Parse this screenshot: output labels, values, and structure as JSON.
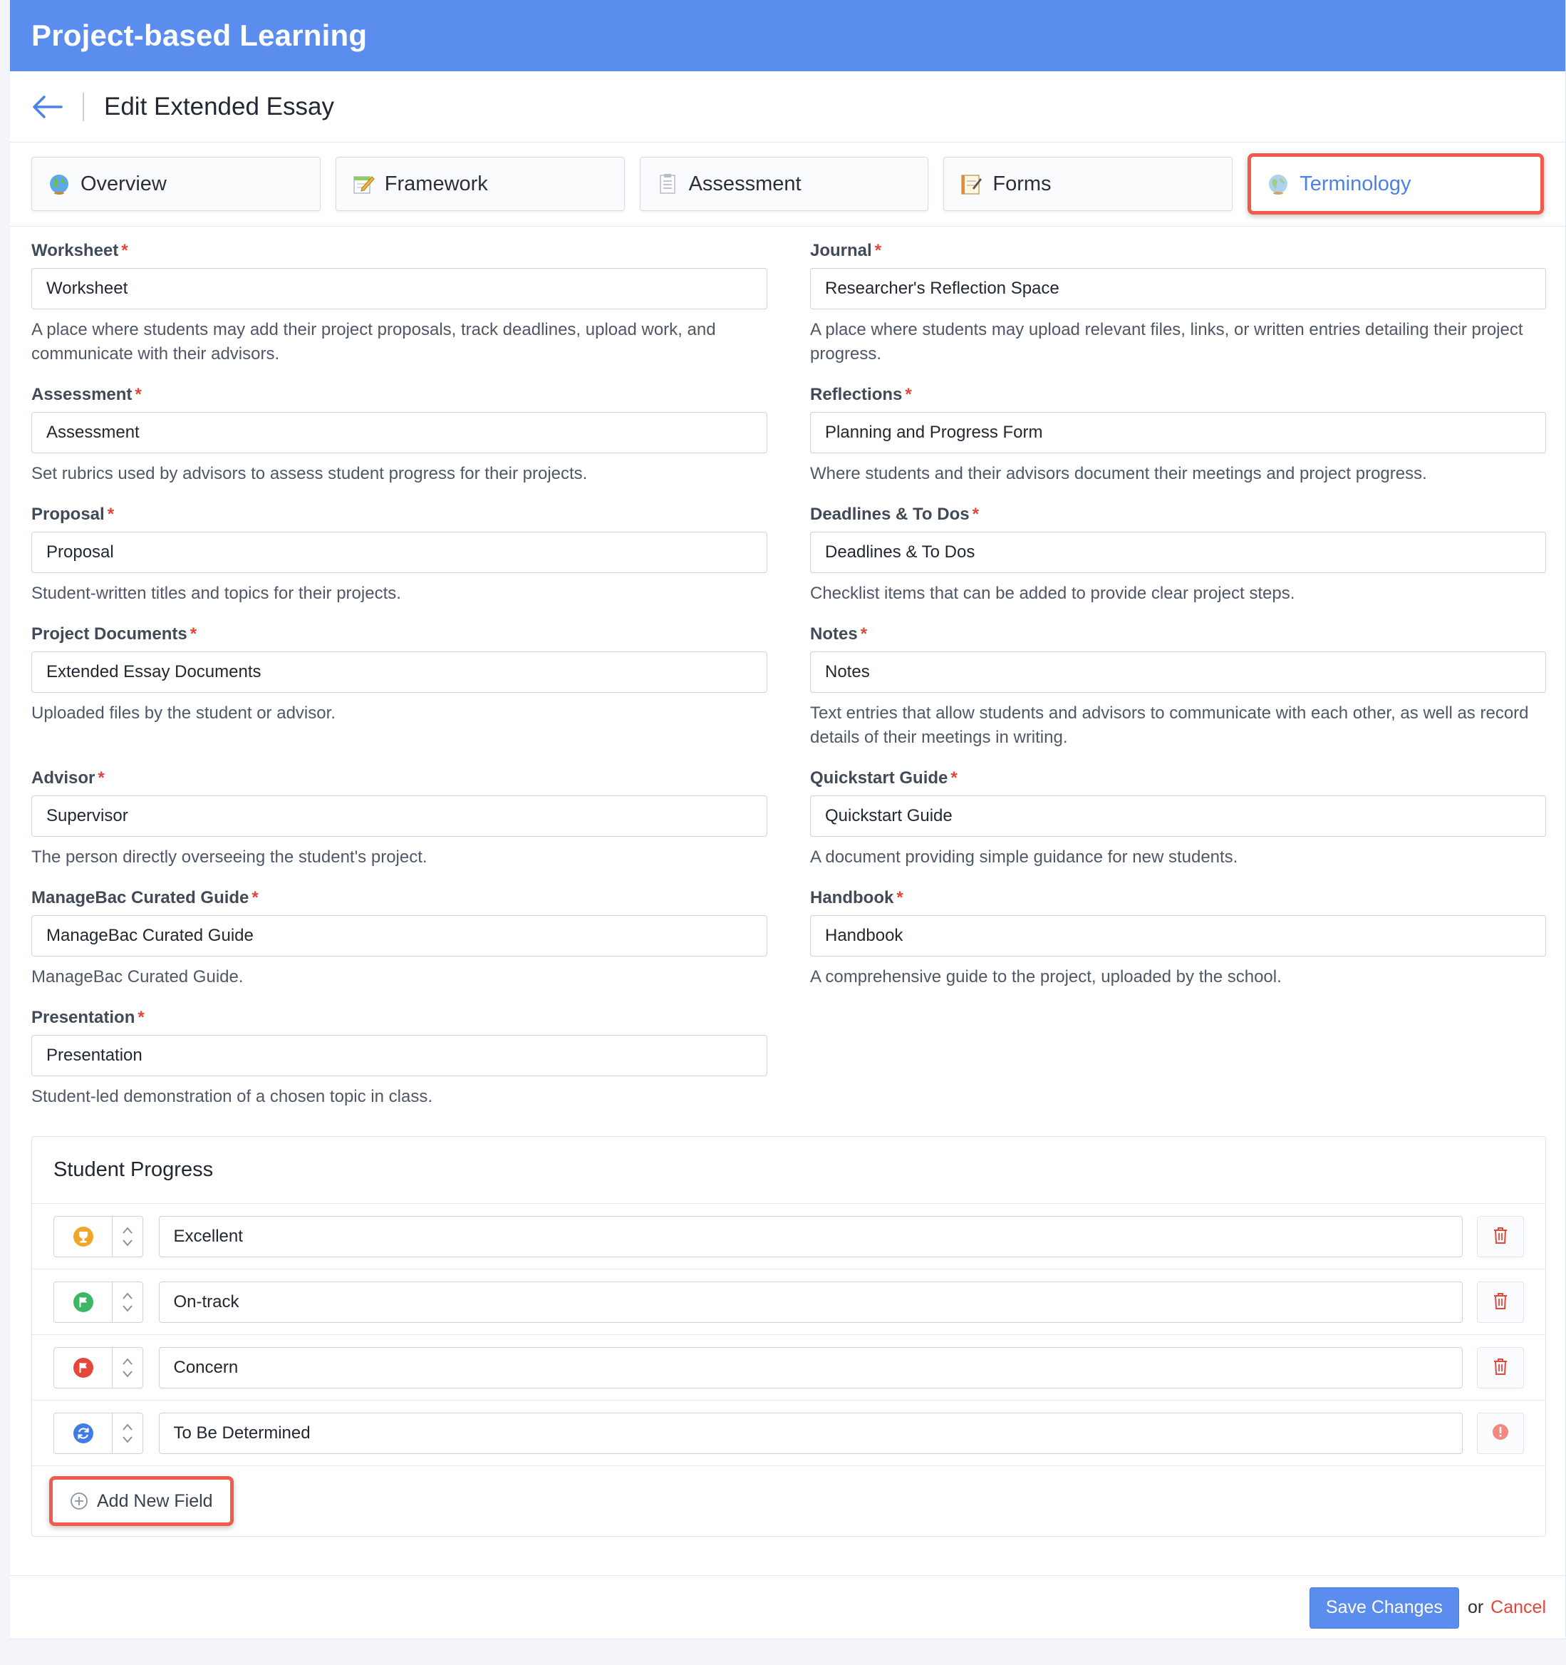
{
  "app": {
    "title": "Project-based Learning"
  },
  "header": {
    "title": "Edit Extended Essay"
  },
  "tabs": [
    {
      "label": "Overview",
      "icon": "globe-icon"
    },
    {
      "label": "Framework",
      "icon": "notepad-pencil-icon"
    },
    {
      "label": "Assessment",
      "icon": "clipboard-icon"
    },
    {
      "label": "Forms",
      "icon": "memo-icon"
    },
    {
      "label": "Terminology",
      "icon": "globe-icon",
      "active": true
    }
  ],
  "fields": {
    "worksheet": {
      "label": "Worksheet",
      "value": "Worksheet",
      "help": "A place where students may add their project proposals, track deadlines, upload work, and communicate with their advisors."
    },
    "journal": {
      "label": "Journal",
      "value": "Researcher's Reflection Space",
      "help": "A place where students may upload relevant files, links, or written entries detailing their project progress."
    },
    "assessment": {
      "label": "Assessment",
      "value": "Assessment",
      "help": "Set rubrics used by advisors to assess student progress for their projects."
    },
    "reflections": {
      "label": "Reflections",
      "value": "Planning and Progress Form",
      "help": "Where students and their advisors document their meetings and project progress."
    },
    "proposal": {
      "label": "Proposal",
      "value": "Proposal",
      "help": "Student-written titles and topics for their projects."
    },
    "deadlines": {
      "label": "Deadlines & To Dos",
      "value": "Deadlines & To Dos",
      "help": "Checklist items that can be added to provide clear project steps."
    },
    "documents": {
      "label": "Project Documents",
      "value": "Extended Essay Documents",
      "help": "Uploaded files by the student or advisor."
    },
    "notes": {
      "label": "Notes",
      "value": "Notes",
      "help": "Text entries that allow students and advisors to communicate with each other, as well as record details of their meetings in writing."
    },
    "advisor": {
      "label": "Advisor",
      "value": "Supervisor",
      "help": "The person directly overseeing the student's project."
    },
    "quickstart": {
      "label": "Quickstart Guide",
      "value": "Quickstart Guide",
      "help": "A document providing simple guidance for new students."
    },
    "curated": {
      "label": "ManageBac Curated Guide",
      "value": "ManageBac Curated Guide",
      "help": "ManageBac Curated Guide."
    },
    "handbook": {
      "label": "Handbook",
      "value": "Handbook",
      "help": "A comprehensive guide to the project, uploaded by the school."
    },
    "presentation": {
      "label": "Presentation",
      "value": "Presentation",
      "help": "Student-led demonstration of a chosen topic in class."
    }
  },
  "required_marker": "*",
  "progress": {
    "title": "Student Progress",
    "rows": [
      {
        "value": "Excellent",
        "icon": "trophy-icon",
        "color": "#f0a52b",
        "action_icon": "trash-icon"
      },
      {
        "value": "On-track",
        "icon": "flag-icon",
        "color": "#3cb865",
        "action_icon": "trash-icon"
      },
      {
        "value": "Concern",
        "icon": "flag-icon",
        "color": "#e5473b",
        "action_icon": "trash-icon"
      },
      {
        "value": "To Be Determined",
        "icon": "refresh-icon",
        "color": "#3f7de6",
        "action_icon": "alert-circle-icon"
      }
    ],
    "add_label": "Add New Field"
  },
  "footer": {
    "save_label": "Save Changes",
    "or_text": "or",
    "cancel_label": "Cancel"
  },
  "colors": {
    "brand": "#5b8def",
    "danger": "#e0463a",
    "highlight": "#ef5b4c"
  }
}
